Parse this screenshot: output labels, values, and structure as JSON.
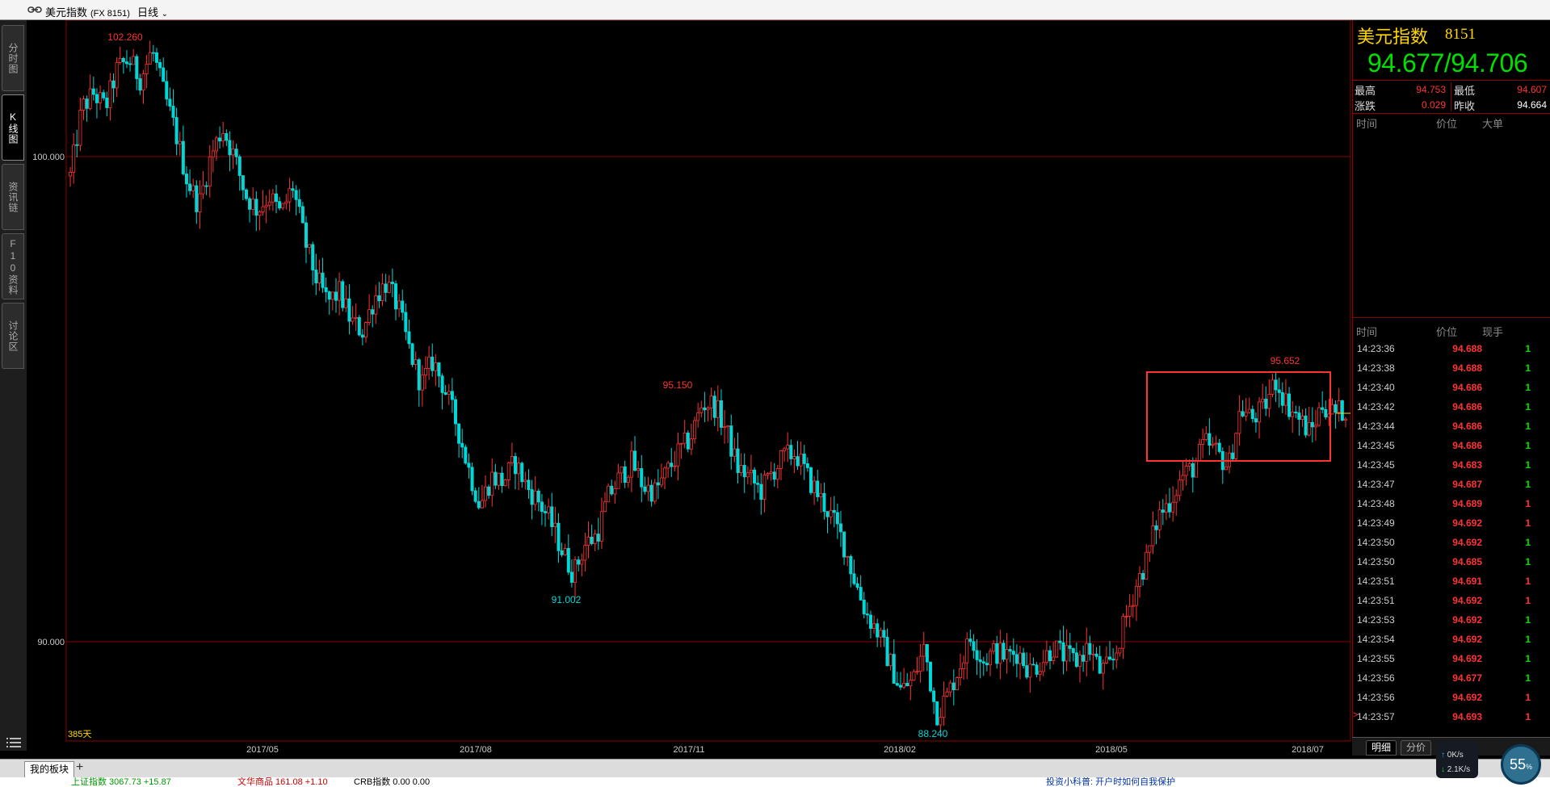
{
  "window": {
    "instrument_name": "美元指数",
    "instrument_code": "(FX 8151)",
    "period": "日线"
  },
  "left_tabs": [
    "分时图",
    "K线图",
    "资讯链",
    "F10资料",
    "讨论区"
  ],
  "chart_data": {
    "type": "candlestick",
    "y_ticks": [
      "100.000",
      "90.000"
    ],
    "x_ticks": [
      "2017/05",
      "2017/08",
      "2017/11",
      "2018/02",
      "2018/05",
      "2018/07"
    ],
    "annotations": [
      {
        "label": "102.260",
        "kind": "high"
      },
      {
        "label": "95.150",
        "kind": "high"
      },
      {
        "label": "91.002",
        "kind": "low"
      },
      {
        "label": "88.240",
        "kind": "low"
      },
      {
        "label": "95.652",
        "kind": "high"
      }
    ],
    "day_count_label": "385天",
    "price_path": [
      [
        0,
        99.6
      ],
      [
        5,
        101.0
      ],
      [
        10,
        101.3
      ],
      [
        15,
        101.0
      ],
      [
        20,
        101.8
      ],
      [
        25,
        102.0
      ],
      [
        30,
        101.6
      ],
      [
        35,
        102.2
      ],
      [
        40,
        101.3
      ],
      [
        45,
        100.5
      ],
      [
        50,
        99.5
      ],
      [
        55,
        99.0
      ],
      [
        60,
        100.0
      ],
      [
        65,
        100.6
      ],
      [
        70,
        100.0
      ],
      [
        75,
        99.2
      ],
      [
        80,
        98.9
      ],
      [
        85,
        99.2
      ],
      [
        90,
        98.8
      ],
      [
        95,
        99.4
      ],
      [
        100,
        98.3
      ],
      [
        105,
        97.5
      ],
      [
        110,
        97.0
      ],
      [
        115,
        97.2
      ],
      [
        120,
        96.6
      ],
      [
        125,
        96.4
      ],
      [
        130,
        97.1
      ],
      [
        135,
        97.4
      ],
      [
        140,
        96.9
      ],
      [
        145,
        96.0
      ],
      [
        150,
        95.3
      ],
      [
        155,
        95.8
      ],
      [
        160,
        95.2
      ],
      [
        165,
        94.5
      ],
      [
        170,
        93.6
      ],
      [
        175,
        92.8
      ],
      [
        180,
        93.4
      ],
      [
        185,
        93.3
      ],
      [
        190,
        93.7
      ],
      [
        195,
        93.2
      ],
      [
        200,
        92.9
      ],
      [
        205,
        92.5
      ],
      [
        210,
        91.9
      ],
      [
        215,
        91.4
      ],
      [
        220,
        92.0
      ],
      [
        225,
        92.2
      ],
      [
        230,
        93.0
      ],
      [
        235,
        93.4
      ],
      [
        240,
        93.7
      ],
      [
        245,
        93.2
      ],
      [
        250,
        93.1
      ],
      [
        255,
        93.5
      ],
      [
        260,
        93.9
      ],
      [
        265,
        94.2
      ],
      [
        270,
        94.9
      ],
      [
        275,
        94.9
      ],
      [
        280,
        94.4
      ],
      [
        285,
        93.6
      ],
      [
        290,
        93.4
      ],
      [
        295,
        93.1
      ],
      [
        300,
        93.5
      ],
      [
        305,
        93.8
      ],
      [
        310,
        93.9
      ],
      [
        315,
        93.4
      ],
      [
        320,
        93.0
      ],
      [
        325,
        92.6
      ],
      [
        330,
        92.1
      ],
      [
        335,
        91.3
      ],
      [
        340,
        90.6
      ],
      [
        345,
        90.2
      ],
      [
        350,
        89.6
      ],
      [
        355,
        89.0
      ],
      [
        360,
        89.2
      ],
      [
        365,
        89.9
      ],
      [
        370,
        88.5
      ],
      [
        375,
        88.9
      ],
      [
        380,
        89.5
      ],
      [
        385,
        90.1
      ],
      [
        390,
        89.6
      ],
      [
        395,
        89.8
      ],
      [
        400,
        89.7
      ],
      [
        405,
        89.8
      ],
      [
        410,
        89.4
      ],
      [
        415,
        89.6
      ],
      [
        420,
        89.9
      ],
      [
        425,
        89.7
      ],
      [
        430,
        89.6
      ],
      [
        435,
        89.9
      ],
      [
        440,
        89.4
      ],
      [
        445,
        89.5
      ],
      [
        450,
        90.3
      ],
      [
        455,
        91.1
      ],
      [
        460,
        91.7
      ],
      [
        465,
        92.6
      ],
      [
        470,
        92.9
      ],
      [
        475,
        93.4
      ],
      [
        480,
        93.6
      ],
      [
        485,
        94.1
      ],
      [
        490,
        93.9
      ],
      [
        495,
        93.6
      ],
      [
        500,
        94.8
      ],
      [
        505,
        94.6
      ],
      [
        510,
        94.8
      ],
      [
        515,
        95.4
      ],
      [
        520,
        94.9
      ],
      [
        525,
        94.6
      ],
      [
        530,
        94.3
      ],
      [
        535,
        94.9
      ],
      [
        540,
        94.7
      ],
      [
        545,
        94.8
      ]
    ]
  },
  "quote": {
    "name": "美元指数",
    "code": "8151",
    "bid_ask": "94.677/94.706",
    "stats": {
      "high_label": "最高",
      "high": "94.753",
      "low_label": "最低",
      "low": "94.607",
      "change_label": "涨跌",
      "change": "0.029",
      "prev_close_label": "昨收",
      "prev_close": "94.664"
    },
    "big_orders_header": {
      "time": "时间",
      "price": "价位",
      "size": "大单"
    },
    "ticks_header": {
      "time": "时间",
      "price": "价位",
      "size": "现手"
    },
    "ticks": [
      {
        "time": "14:23:36",
        "price": "94.688",
        "size": "1",
        "dir": "green"
      },
      {
        "time": "14:23:38",
        "price": "94.688",
        "size": "1",
        "dir": "green"
      },
      {
        "time": "14:23:40",
        "price": "94.686",
        "size": "1",
        "dir": "green"
      },
      {
        "time": "14:23:42",
        "price": "94.686",
        "size": "1",
        "dir": "green"
      },
      {
        "time": "14:23:44",
        "price": "94.686",
        "size": "1",
        "dir": "green"
      },
      {
        "time": "14:23:45",
        "price": "94.686",
        "size": "1",
        "dir": "green"
      },
      {
        "time": "14:23:45",
        "price": "94.683",
        "size": "1",
        "dir": "green"
      },
      {
        "time": "14:23:47",
        "price": "94.687",
        "size": "1",
        "dir": "green"
      },
      {
        "time": "14:23:48",
        "price": "94.689",
        "size": "1",
        "dir": "red"
      },
      {
        "time": "14:23:49",
        "price": "94.692",
        "size": "1",
        "dir": "red"
      },
      {
        "time": "14:23:50",
        "price": "94.692",
        "size": "1",
        "dir": "green"
      },
      {
        "time": "14:23:50",
        "price": "94.685",
        "size": "1",
        "dir": "green"
      },
      {
        "time": "14:23:51",
        "price": "94.691",
        "size": "1",
        "dir": "red"
      },
      {
        "time": "14:23:51",
        "price": "94.692",
        "size": "1",
        "dir": "red"
      },
      {
        "time": "14:23:53",
        "price": "94.692",
        "size": "1",
        "dir": "green"
      },
      {
        "time": "14:23:54",
        "price": "94.692",
        "size": "1",
        "dir": "green"
      },
      {
        "time": "14:23:55",
        "price": "94.692",
        "size": "1",
        "dir": "green"
      },
      {
        "time": "14:23:56",
        "price": "94.677",
        "size": "1",
        "dir": "green"
      },
      {
        "time": "14:23:56",
        "price": "94.692",
        "size": "1",
        "dir": "red"
      },
      {
        "time": "14:23:57",
        "price": "94.693",
        "size": "1",
        "dir": "red"
      }
    ],
    "bottom_tabs": [
      "明细",
      "分价"
    ]
  },
  "bottom_bar": {
    "tab_label": "我的板块",
    "add_label": "+",
    "ticker": [
      {
        "text": "上证指数 3067.73 +15.87",
        "color": "#009900"
      },
      {
        "text": "文华商品 161.08 +1.10",
        "color": "#cc0000"
      },
      {
        "text": "CRB指数 0.00 0.00",
        "color": "#000000"
      },
      {
        "text": "投资小科普: 开户时如何自我保护",
        "color": "#0033aa"
      }
    ]
  },
  "speed_widget": {
    "upload": "0K/s",
    "download": "2.1K/s",
    "percent": "55",
    "percent_unit": "%"
  },
  "colors": {
    "up": "#ff3333",
    "down": "#00d8d8",
    "grid": "#8b0000",
    "label_yellow": "#ffd700",
    "price_green": "#00e000",
    "box": "#ff3333"
  }
}
